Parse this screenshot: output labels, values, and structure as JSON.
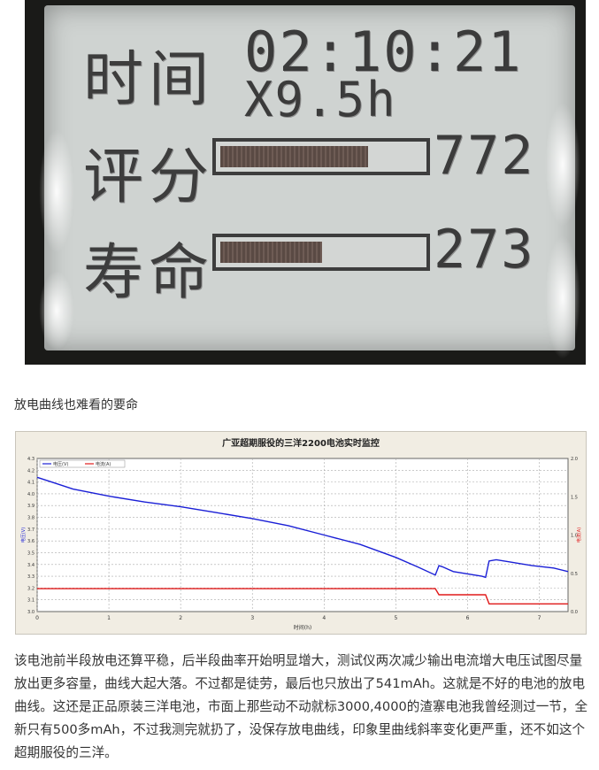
{
  "lcd": {
    "time_label": "时间",
    "time_value": "02:10:21",
    "time_sub": "X9.5h",
    "score_label": "评分",
    "score_value": "772",
    "score_fill": 0.74,
    "life_label": "寿命",
    "life_value": "273",
    "life_fill": 0.51
  },
  "caption": "放电曲线也难看的要命",
  "paragraph": "该电池前半段放电还算平稳，后半段曲率开始明显增大，测试仪两次减少输出电流增大电压试图尽量放出更多容量，曲线大起大落。不过都是徒劳，最后也只放出了541mAh。这就是不好的电池的放电曲线。这还是正品原装三洋电池，市面上那些动不动就标3000,4000的渣寨电池我曾经测过一节，全新只有500多mAh，不过我测完就扔了，没保存放电曲线，印象里曲线斜率变化更严重，还不如这个超期服役的三洋。",
  "chart_data": {
    "type": "line",
    "title": "广亚超期服役的三洋2200电池实时监控",
    "xlabel": "时间(h)",
    "ylabel_left": "电压(V)",
    "ylabel_right": "电流(A)",
    "legend": [
      "电压(V)",
      "电流(A)"
    ],
    "legend_placement": "top-left",
    "grid": true,
    "xlim": [
      0,
      7.4
    ],
    "ylim_left": [
      3.0,
      4.3
    ],
    "ylim_right": [
      0.0,
      2.0
    ],
    "x_ticks": [
      "0",
      "1",
      "2",
      "3",
      "4",
      "5",
      "6",
      "7"
    ],
    "y_left_ticks": [
      "3.0",
      "3.1",
      "3.2",
      "3.3",
      "3.4",
      "3.5",
      "3.6",
      "3.7",
      "3.8",
      "3.9",
      "4.0",
      "4.1",
      "4.2",
      "4.3"
    ],
    "y_right_ticks": [
      "0.0",
      "0.5",
      "1.0",
      "1.5",
      "2.0"
    ],
    "colors": {
      "voltage": "#1a1fd6",
      "current": "#e01a1a",
      "plot_bg": "#ffffff",
      "frame_bg": "#f1ede3"
    },
    "series": [
      {
        "name": "电压(V)",
        "axis": "left",
        "x": [
          0,
          0.2,
          0.5,
          1.0,
          1.5,
          2.0,
          2.5,
          3.0,
          3.5,
          4.0,
          4.5,
          5.0,
          5.3,
          5.55,
          5.6,
          5.65,
          5.8,
          6.0,
          6.2,
          6.25,
          6.3,
          6.4,
          6.6,
          6.9,
          7.2,
          7.4
        ],
        "values": [
          4.14,
          4.1,
          4.04,
          3.98,
          3.93,
          3.89,
          3.84,
          3.79,
          3.73,
          3.65,
          3.57,
          3.46,
          3.38,
          3.31,
          3.39,
          3.38,
          3.34,
          3.32,
          3.3,
          3.29,
          3.43,
          3.44,
          3.42,
          3.39,
          3.37,
          3.34
        ]
      },
      {
        "name": "电流(A)",
        "axis": "right",
        "x": [
          0,
          1,
          2,
          3,
          4,
          5,
          5.55,
          5.6,
          6.2,
          6.25,
          6.3,
          7.0,
          7.4
        ],
        "values": [
          0.3,
          0.3,
          0.3,
          0.3,
          0.3,
          0.3,
          0.3,
          0.22,
          0.22,
          0.22,
          0.1,
          0.1,
          0.1
        ]
      }
    ]
  }
}
